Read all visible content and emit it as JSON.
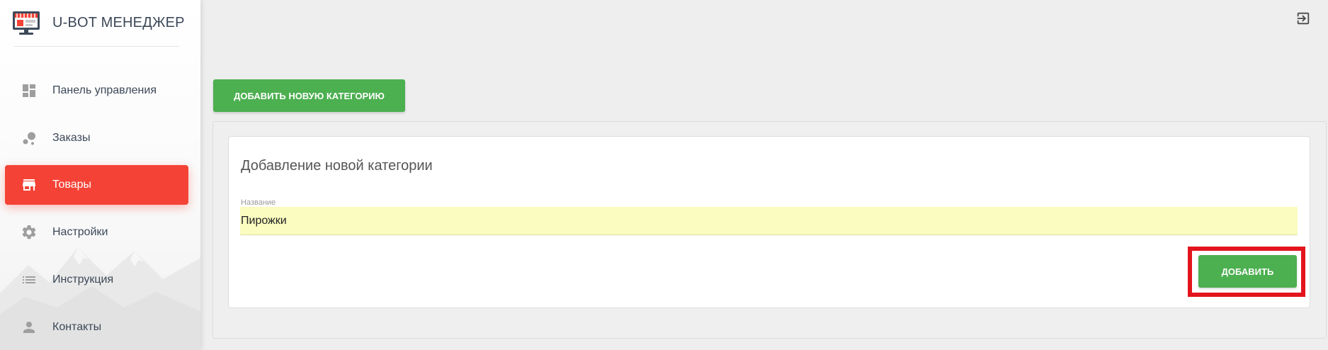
{
  "brand": {
    "title": "U-BOT МЕНЕДЖЕР",
    "logo_icon": "store-screen-logo-icon"
  },
  "sidebar": {
    "items": [
      {
        "label": "Панель управления",
        "icon": "dashboard-icon",
        "active": false
      },
      {
        "label": "Заказы",
        "icon": "bubbles-icon",
        "active": false
      },
      {
        "label": "Товары",
        "icon": "store-icon",
        "active": true
      },
      {
        "label": "Настройки",
        "icon": "gear-icon",
        "active": false
      },
      {
        "label": "Инструкция",
        "icon": "list-icon",
        "active": false
      },
      {
        "label": "Контакты",
        "icon": "person-icon",
        "active": false
      }
    ]
  },
  "header": {
    "logout_icon": "logout-icon"
  },
  "main": {
    "add_category_label": "ДОБАВИТЬ НОВУЮ КАТЕГОРИЮ",
    "form": {
      "title": "Добавление новой категории",
      "name_label": "Название",
      "name_value": "Пирожки",
      "submit_label": "ДОБАВИТЬ"
    }
  },
  "colors": {
    "accent_active": "#f44336",
    "button_green": "#4caf50",
    "highlight_red": "#e3141d",
    "input_fill": "#fafcc0"
  }
}
